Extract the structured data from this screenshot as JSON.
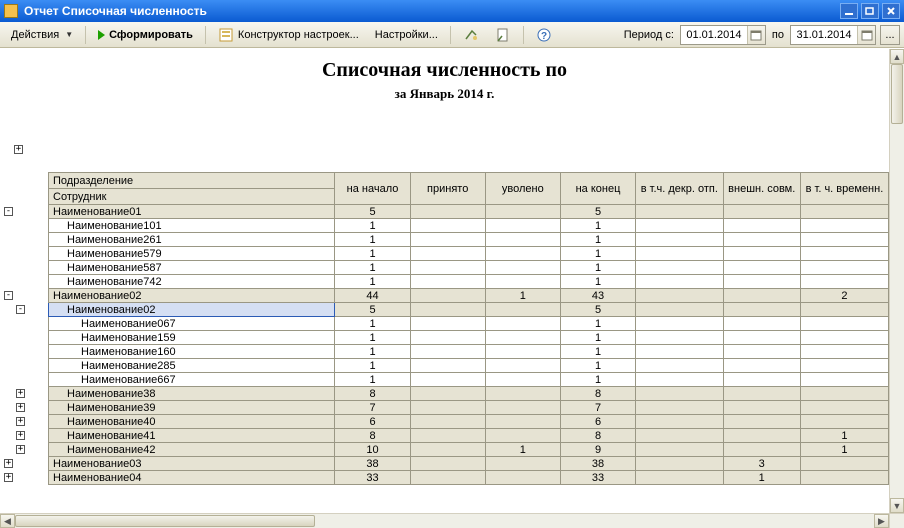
{
  "window": {
    "title": "Отчет Списочная численность",
    "controls": {
      "min": "_",
      "restore": "❐",
      "close": "×"
    }
  },
  "toolbar": {
    "actions_label": "Действия",
    "form_label": "Сформировать",
    "constructor_label": "Конструктор настроек...",
    "settings_label": "Настройки...",
    "period_label": "Период с:",
    "date_from": "01.01.2014",
    "date_to_label": "по",
    "date_to": "31.01.2014",
    "dots": "..."
  },
  "report": {
    "title": "Списочная численность по",
    "subtitle": "за Январь 2014 г."
  },
  "columns": {
    "dept": "Подразделение",
    "emp": "Сотрудник",
    "start": "на начало",
    "hired": "принято",
    "fired": "уволено",
    "end": "на конец",
    "decree": "в т.ч. декр. отп.",
    "extern": "внешн. совм.",
    "temp": "в т. ч. временн."
  },
  "rows": [
    {
      "type": "group",
      "depth": 0,
      "expander": "-",
      "name": "Наименование01",
      "start": "5",
      "hired": "",
      "fired": "",
      "end": "5",
      "decree": "",
      "extern": "",
      "temp": ""
    },
    {
      "type": "leaf",
      "depth": 1,
      "expander": "",
      "name": "Наименование101",
      "start": "1",
      "hired": "",
      "fired": "",
      "end": "1",
      "decree": "",
      "extern": "",
      "temp": ""
    },
    {
      "type": "leaf",
      "depth": 1,
      "expander": "",
      "name": "Наименование261",
      "start": "1",
      "hired": "",
      "fired": "",
      "end": "1",
      "decree": "",
      "extern": "",
      "temp": ""
    },
    {
      "type": "leaf",
      "depth": 1,
      "expander": "",
      "name": "Наименование579",
      "start": "1",
      "hired": "",
      "fired": "",
      "end": "1",
      "decree": "",
      "extern": "",
      "temp": ""
    },
    {
      "type": "leaf",
      "depth": 1,
      "expander": "",
      "name": "Наименование587",
      "start": "1",
      "hired": "",
      "fired": "",
      "end": "1",
      "decree": "",
      "extern": "",
      "temp": ""
    },
    {
      "type": "leaf",
      "depth": 1,
      "expander": "",
      "name": "Наименование742",
      "start": "1",
      "hired": "",
      "fired": "",
      "end": "1",
      "decree": "",
      "extern": "",
      "temp": ""
    },
    {
      "type": "group",
      "depth": 0,
      "expander": "-",
      "name": "Наименование02",
      "start": "44",
      "hired": "",
      "fired": "1",
      "end": "43",
      "decree": "",
      "extern": "",
      "temp": "2"
    },
    {
      "type": "group",
      "depth": 1,
      "expander": "-",
      "selected": true,
      "name": "Наименование02",
      "start": "5",
      "hired": "",
      "fired": "",
      "end": "5",
      "decree": "",
      "extern": "",
      "temp": ""
    },
    {
      "type": "leaf",
      "depth": 2,
      "expander": "",
      "name": "Наименование067",
      "start": "1",
      "hired": "",
      "fired": "",
      "end": "1",
      "decree": "",
      "extern": "",
      "temp": ""
    },
    {
      "type": "leaf",
      "depth": 2,
      "expander": "",
      "name": "Наименование159",
      "start": "1",
      "hired": "",
      "fired": "",
      "end": "1",
      "decree": "",
      "extern": "",
      "temp": ""
    },
    {
      "type": "leaf",
      "depth": 2,
      "expander": "",
      "name": "Наименование160",
      "start": "1",
      "hired": "",
      "fired": "",
      "end": "1",
      "decree": "",
      "extern": "",
      "temp": ""
    },
    {
      "type": "leaf",
      "depth": 2,
      "expander": "",
      "name": "Наименование285",
      "start": "1",
      "hired": "",
      "fired": "",
      "end": "1",
      "decree": "",
      "extern": "",
      "temp": ""
    },
    {
      "type": "leaf",
      "depth": 2,
      "expander": "",
      "name": "Наименование667",
      "start": "1",
      "hired": "",
      "fired": "",
      "end": "1",
      "decree": "",
      "extern": "",
      "temp": ""
    },
    {
      "type": "group",
      "depth": 1,
      "expander": "+",
      "name": "Наименование38",
      "start": "8",
      "hired": "",
      "fired": "",
      "end": "8",
      "decree": "",
      "extern": "",
      "temp": ""
    },
    {
      "type": "group",
      "depth": 1,
      "expander": "+",
      "name": "Наименование39",
      "start": "7",
      "hired": "",
      "fired": "",
      "end": "7",
      "decree": "",
      "extern": "",
      "temp": ""
    },
    {
      "type": "group",
      "depth": 1,
      "expander": "+",
      "name": "Наименование40",
      "start": "6",
      "hired": "",
      "fired": "",
      "end": "6",
      "decree": "",
      "extern": "",
      "temp": ""
    },
    {
      "type": "group",
      "depth": 1,
      "expander": "+",
      "name": "Наименование41",
      "start": "8",
      "hired": "",
      "fired": "",
      "end": "8",
      "decree": "",
      "extern": "",
      "temp": "1"
    },
    {
      "type": "group",
      "depth": 1,
      "expander": "+",
      "name": "Наименование42",
      "start": "10",
      "hired": "",
      "fired": "1",
      "end": "9",
      "decree": "",
      "extern": "",
      "temp": "1"
    },
    {
      "type": "group",
      "depth": 0,
      "expander": "+",
      "name": "Наименование03",
      "start": "38",
      "hired": "",
      "fired": "",
      "end": "38",
      "decree": "",
      "extern": "3",
      "temp": ""
    },
    {
      "type": "group",
      "depth": 0,
      "expander": "+",
      "name": "Наименование04",
      "start": "33",
      "hired": "",
      "fired": "",
      "end": "33",
      "decree": "",
      "extern": "1",
      "temp": ""
    }
  ],
  "chart_data": {
    "type": "table",
    "title": "Списочная численность по — за Январь 2014 г.",
    "columns": [
      "Подразделение / Сотрудник",
      "на начало",
      "принято",
      "уволено",
      "на конец",
      "в т.ч. декр. отп.",
      "внешн. совм.",
      "в т. ч. временн."
    ],
    "rows": [
      [
        "Наименование01",
        5,
        null,
        null,
        5,
        null,
        null,
        null
      ],
      [
        "  Наименование101",
        1,
        null,
        null,
        1,
        null,
        null,
        null
      ],
      [
        "  Наименование261",
        1,
        null,
        null,
        1,
        null,
        null,
        null
      ],
      [
        "  Наименование579",
        1,
        null,
        null,
        1,
        null,
        null,
        null
      ],
      [
        "  Наименование587",
        1,
        null,
        null,
        1,
        null,
        null,
        null
      ],
      [
        "  Наименование742",
        1,
        null,
        null,
        1,
        null,
        null,
        null
      ],
      [
        "Наименование02",
        44,
        null,
        1,
        43,
        null,
        null,
        2
      ],
      [
        "  Наименование02",
        5,
        null,
        null,
        5,
        null,
        null,
        null
      ],
      [
        "    Наименование067",
        1,
        null,
        null,
        1,
        null,
        null,
        null
      ],
      [
        "    Наименование159",
        1,
        null,
        null,
        1,
        null,
        null,
        null
      ],
      [
        "    Наименование160",
        1,
        null,
        null,
        1,
        null,
        null,
        null
      ],
      [
        "    Наименование285",
        1,
        null,
        null,
        1,
        null,
        null,
        null
      ],
      [
        "    Наименование667",
        1,
        null,
        null,
        1,
        null,
        null,
        null
      ],
      [
        "  Наименование38",
        8,
        null,
        null,
        8,
        null,
        null,
        null
      ],
      [
        "  Наименование39",
        7,
        null,
        null,
        7,
        null,
        null,
        null
      ],
      [
        "  Наименование40",
        6,
        null,
        null,
        6,
        null,
        null,
        null
      ],
      [
        "  Наименование41",
        8,
        null,
        null,
        8,
        null,
        null,
        1
      ],
      [
        "  Наименование42",
        10,
        null,
        1,
        9,
        null,
        null,
        1
      ],
      [
        "Наименование03",
        38,
        null,
        null,
        38,
        null,
        3,
        null
      ],
      [
        "Наименование04",
        33,
        null,
        null,
        33,
        null,
        1,
        null
      ]
    ]
  }
}
